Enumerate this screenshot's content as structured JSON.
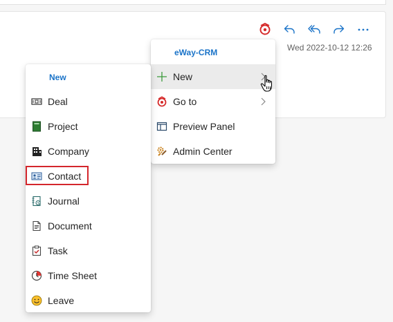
{
  "message": {
    "date": "Wed 2022-10-12 12:26",
    "toolbar": [
      {
        "name": "eway-crm-addin-button",
        "icon": "eway-crm-icon"
      },
      {
        "name": "reply-button",
        "icon": "reply-icon"
      },
      {
        "name": "reply-all-button",
        "icon": "reply-all-icon"
      },
      {
        "name": "forward-button",
        "icon": "forward-icon"
      },
      {
        "name": "more-actions-button",
        "icon": "more-icon"
      }
    ]
  },
  "main_menu": {
    "header": "eWay-CRM",
    "items": [
      {
        "label": "New",
        "icon": "plus-icon",
        "submenu": true,
        "hovered": true
      },
      {
        "label": "Go to",
        "icon": "eway-crm-icon",
        "submenu": true
      },
      {
        "label": "Preview Panel",
        "icon": "preview-panel-icon"
      },
      {
        "label": "Admin Center",
        "icon": "admin-center-icon"
      }
    ]
  },
  "sub_menu": {
    "header": "New",
    "items": [
      {
        "label": "Deal",
        "icon": "deal-icon"
      },
      {
        "label": "Project",
        "icon": "project-icon"
      },
      {
        "label": "Company",
        "icon": "company-icon"
      },
      {
        "label": "Contact",
        "icon": "contact-icon",
        "highlighted": true
      },
      {
        "label": "Journal",
        "icon": "journal-icon"
      },
      {
        "label": "Document",
        "icon": "document-icon"
      },
      {
        "label": "Task",
        "icon": "task-icon"
      },
      {
        "label": "Time Sheet",
        "icon": "time-sheet-icon"
      },
      {
        "label": "Leave",
        "icon": "leave-icon"
      }
    ]
  },
  "colors": {
    "accent": "#1a73c8",
    "highlight_border": "#d4262c",
    "hover_bg": "#ebebeb"
  }
}
